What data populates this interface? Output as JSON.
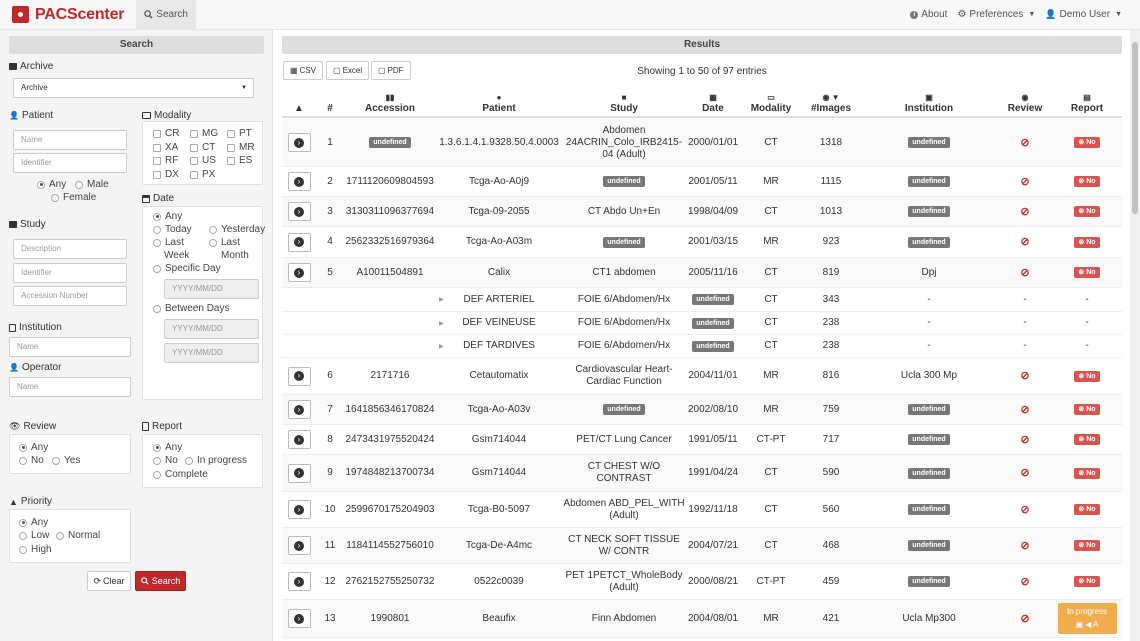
{
  "navbar": {
    "brand": "PACScenter",
    "search": "Search",
    "about": "About",
    "preferences": "Preferences",
    "user": "Demo User"
  },
  "sidebar": {
    "title": "Search",
    "archive": {
      "label": "Archive",
      "value": "Archive"
    },
    "patient": {
      "label": "Patient",
      "name_ph": "Name",
      "id_ph": "Identifier",
      "sex": [
        "Any",
        "Male",
        "Female"
      ]
    },
    "modality": {
      "label": "Modality",
      "options": [
        "CR",
        "MG",
        "PT",
        "XA",
        "CT",
        "MR",
        "RF",
        "US",
        "ES",
        "DX",
        "PX"
      ]
    },
    "study": {
      "label": "Study",
      "desc_ph": "Description",
      "id_ph": "Identifier",
      "acc_ph": "Accession Number"
    },
    "date": {
      "label": "Date",
      "any": "Any",
      "today": "Today",
      "yesterday": "Yesterday",
      "last": "Last",
      "week": "Week",
      "month": "Month",
      "specific": "Specific Day",
      "between": "Between Days",
      "date_ph": "YYYY/MM/DD"
    },
    "institution": {
      "label": "Institution",
      "ph": "Name"
    },
    "operator": {
      "label": "Operator",
      "ph": "Name"
    },
    "review": {
      "label": "Review",
      "options": [
        "Any",
        "No",
        "Yes"
      ]
    },
    "report": {
      "label": "Report",
      "options": [
        "Any",
        "No",
        "In progress",
        "Complete"
      ]
    },
    "priority": {
      "label": "Priority",
      "options": [
        "Any",
        "Low",
        "Normal",
        "High"
      ]
    },
    "clear": "Clear",
    "search": "Search"
  },
  "results": {
    "title": "Results",
    "csv": "CSV",
    "excel": "Excel",
    "pdf": "PDF",
    "entries": "Showing 1 to 50 of 97 entries",
    "columns": {
      "num": "#",
      "accession": "Accession",
      "patient": "Patient",
      "study": "Study",
      "date": "Date",
      "modality": "Modality",
      "images": "#Images",
      "institution": "Institution",
      "review": "Review",
      "report": "Report"
    },
    "rows": [
      {
        "n": "1",
        "acc": "undefined",
        "patient": "1.3.6.1.4.1.9328.50.4.0003",
        "study": "Abdomen 24ACRIN_Colo_IRB2415-04 (Adult)",
        "date": "2000/01/01",
        "mod": "CT",
        "img": "1318",
        "inst": "undefined",
        "report": "No"
      },
      {
        "n": "2",
        "acc": "1711120609804593",
        "patient": "Tcga-Ao-A0j9",
        "study": "undefined",
        "date": "2001/05/11",
        "mod": "MR",
        "img": "1115",
        "inst": "undefined",
        "report": "No"
      },
      {
        "n": "3",
        "acc": "3130311096377694",
        "patient": "Tcga-09-2055",
        "study": "CT Abdo Un+En",
        "date": "1998/04/09",
        "mod": "CT",
        "img": "1013",
        "inst": "undefined",
        "report": "No"
      },
      {
        "n": "4",
        "acc": "2562332516979364",
        "patient": "Tcga-Ao-A03m",
        "study": "undefined",
        "date": "2001/03/15",
        "mod": "MR",
        "img": "923",
        "inst": "undefined",
        "report": "No"
      },
      {
        "n": "5",
        "acc": "A10011504891",
        "patient": "Calix",
        "study": "CT1 abdomen",
        "date": "2005/11/16",
        "mod": "CT",
        "img": "819",
        "inst": "Dpj",
        "report": "No"
      },
      {
        "n": "6",
        "acc": "2171716",
        "patient": "Cetautomatix",
        "study": "Cardiovascular Heart-Cardiac Function",
        "date": "2004/11/01",
        "mod": "MR",
        "img": "816",
        "inst": "Ucla 300 Mp",
        "report": "No"
      },
      {
        "n": "7",
        "acc": "1641856346170824",
        "patient": "Tcga-Ao-A03v",
        "study": "undefined",
        "date": "2002/08/10",
        "mod": "MR",
        "img": "759",
        "inst": "undefined",
        "report": "No"
      },
      {
        "n": "8",
        "acc": "2473431975520424",
        "patient": "Gsm714044",
        "study": "PET/CT Lung Cancer",
        "date": "1991/05/11",
        "mod": "CT-PT",
        "img": "717",
        "inst": "undefined",
        "report": "No"
      },
      {
        "n": "9",
        "acc": "1974848213700734",
        "patient": "Gsm714044",
        "study": "CT CHEST W/O CONTRAST",
        "date": "1991/04/24",
        "mod": "CT",
        "img": "590",
        "inst": "undefined",
        "report": "No"
      },
      {
        "n": "10",
        "acc": "2599670175204903",
        "patient": "Tcga-B0-5097",
        "study": "Abdomen ABD_PEL_WITH (Adult)",
        "date": "1992/11/18",
        "mod": "CT",
        "img": "560",
        "inst": "undefined",
        "report": "No"
      },
      {
        "n": "11",
        "acc": "1184114552756010",
        "patient": "Tcga-De-A4mc",
        "study": "CT NECK SOFT TISSUE W/ CONTR",
        "date": "2004/07/21",
        "mod": "CT",
        "img": "468",
        "inst": "undefined",
        "report": "No"
      },
      {
        "n": "12",
        "acc": "2762152755250732",
        "patient": "0522c0039",
        "study": "PET 1PETCT_WholeBody (Adult)",
        "date": "2000/08/21",
        "mod": "CT-PT",
        "img": "459",
        "inst": "undefined",
        "report": "No"
      },
      {
        "n": "13",
        "acc": "1990801",
        "patient": "Beaufix",
        "study": "Finn Abdomen",
        "date": "2004/08/01",
        "mod": "MR",
        "img": "421",
        "inst": "Ucla Mp300",
        "report": "In progress"
      }
    ],
    "series": [
      {
        "name": "DEF ARTERIEL",
        "study": "FOIE 6/Abdomen/Hx",
        "date": "undefined",
        "mod": "CT",
        "img": "343",
        "inst": "-",
        "review": "-",
        "report": "-"
      },
      {
        "name": "DEF VEINEUSE",
        "study": "FOIE 6/Abdomen/Hx",
        "date": "undefined",
        "mod": "CT",
        "img": "238",
        "inst": "-",
        "review": "-",
        "report": "-"
      },
      {
        "name": "DEF TARDIVES",
        "study": "FOIE 6/Abdomen/Hx",
        "date": "undefined",
        "mod": "CT",
        "img": "238",
        "inst": "-",
        "review": "-",
        "report": "-"
      }
    ]
  }
}
